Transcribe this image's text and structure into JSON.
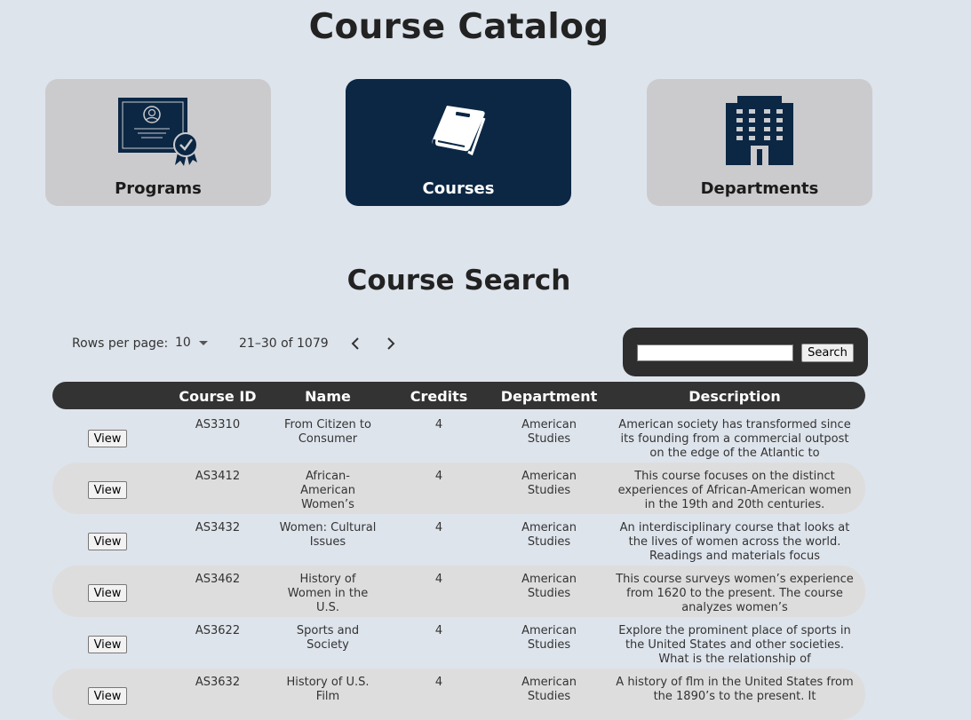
{
  "page": {
    "title": "Course Catalog"
  },
  "nav": {
    "cards": [
      {
        "label": "Programs",
        "icon": "certificate-icon",
        "active": false
      },
      {
        "label": "Courses",
        "icon": "book-icon",
        "active": true
      },
      {
        "label": "Departments",
        "icon": "building-icon",
        "active": false
      }
    ]
  },
  "search_section": {
    "title": "Course Search",
    "rows_per_page_label": "Rows per page:",
    "rows_per_page_value": "10",
    "range_text": "21–30 of 1079",
    "search_placeholder": "",
    "search_button": "Search"
  },
  "table": {
    "columns": [
      "",
      "Course ID",
      "Name",
      "Credits",
      "Department",
      "Description"
    ],
    "view_label": "View",
    "rows": [
      {
        "id": "AS3310",
        "name": "From Citizen to Consumer",
        "credits": "4",
        "department": "American Studies",
        "description": "American society has transformed since its founding from a commercial outpost on the edge of the Atlantic to"
      },
      {
        "id": "AS3412",
        "name": "African-American Women’s",
        "credits": "4",
        "department": "American Studies",
        "description": "This course focuses on the distinct experiences of African-American women in the 19th and 20th centuries."
      },
      {
        "id": "AS3432",
        "name": "Women: Cultural Issues",
        "credits": "4",
        "department": "American Studies",
        "description": "An interdisciplinary course that looks at the lives of women across the world. Readings and materials focus"
      },
      {
        "id": "AS3462",
        "name": "History of Women in the U.S.",
        "credits": "4",
        "department": "American Studies",
        "description": "This course surveys women’s experience from 1620 to the present. The course analyzes women’s"
      },
      {
        "id": "AS3622",
        "name": "Sports and Society",
        "credits": "4",
        "department": "American Studies",
        "description": "Explore the prominent place of sports in the United States and other societies. What is the relationship of"
      },
      {
        "id": "AS3632",
        "name": "History of U.S. Film",
        "credits": "4",
        "department": "American Studies",
        "description": "A history of flm in the United States from the 1890’s to the present. It"
      }
    ]
  },
  "colors": {
    "background": "#dee4ec",
    "card": "#cbcbce",
    "card_active": "#0b2744",
    "table_header": "#333333",
    "row_alt": "#dddddd"
  }
}
